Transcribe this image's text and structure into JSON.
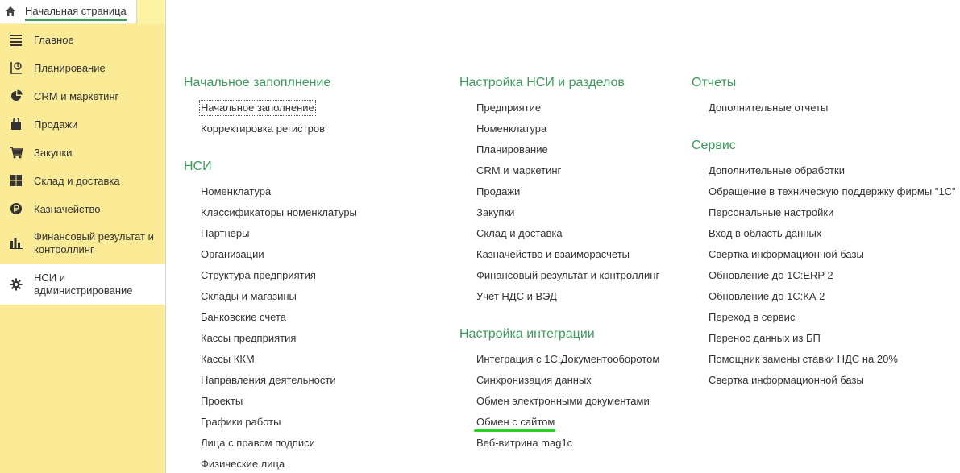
{
  "tab": {
    "label": "Начальная страница"
  },
  "sidebar": {
    "items": [
      {
        "label": "Главное",
        "icon": "menu-lines-icon"
      },
      {
        "label": "Планирование",
        "icon": "planning-icon"
      },
      {
        "label": "CRM и маркетинг",
        "icon": "pie-chart-icon"
      },
      {
        "label": "Продажи",
        "icon": "shopping-bag-icon"
      },
      {
        "label": "Закупки",
        "icon": "cart-icon"
      },
      {
        "label": "Склад и доставка",
        "icon": "warehouse-grid-icon"
      },
      {
        "label": "Казначейство",
        "icon": "ruble-coin-icon"
      },
      {
        "label": "Финансовый результат и контроллинг",
        "icon": "bar-chart-icon"
      },
      {
        "label": "НСИ и администрирование",
        "icon": "gear-icon"
      }
    ]
  },
  "groups": {
    "initial": {
      "title": "Начальное запоплнение",
      "links": [
        "Начальное заполнение",
        "Корректировка регистров"
      ]
    },
    "nsi": {
      "title": "НСИ",
      "links": [
        "Номенклатура",
        "Классификаторы номенклатуры",
        "Партнеры",
        "Организации",
        "Структура предприятия",
        "Склады и магазины",
        "Банковские счета",
        "Кассы предприятия",
        "Кассы ККМ",
        "Направления деятельности",
        "Проекты",
        "Графики работы",
        "Лица с правом подписи",
        "Физические лица"
      ]
    },
    "nsi_settings": {
      "title": "Настройка НСИ и разделов",
      "links": [
        "Предприятие",
        "Номенклатура",
        "Планирование",
        "CRM и маркетинг",
        "Продажи",
        "Закупки",
        "Склад и доставка",
        "Казначейство и взаиморасчеты",
        "Финансовый результат и контроллинг",
        "Учет НДС и ВЭД"
      ]
    },
    "integration": {
      "title": "Настройка интеграции",
      "links": [
        "Интеграция с 1С:Документооборотом",
        "Синхронизация данных",
        "Обмен электронными документами",
        "Обмен с сайтом",
        "Веб-витрина mag1c"
      ]
    },
    "reports": {
      "title": "Отчеты",
      "links": [
        "Дополнительные отчеты"
      ]
    },
    "service": {
      "title": "Сервис",
      "links": [
        "Дополнительные обработки",
        "Обращение в техническую поддержку фирмы \"1С\"",
        "Персональные настройки",
        "Вход в область данных",
        "Свертка информационной базы",
        "Обновление до 1С:ERP 2",
        "Обновление до 1С:КА 2",
        "Переход в сервис",
        "Перенос данных из БП",
        "Помощник замены ставки НДС на 20%",
        "Свертка информационной базы"
      ]
    }
  },
  "colors": {
    "accent_green": "#3a9b5a",
    "sidebar_bg": "#fbeb97",
    "highlight_underline": "#28d21e"
  }
}
